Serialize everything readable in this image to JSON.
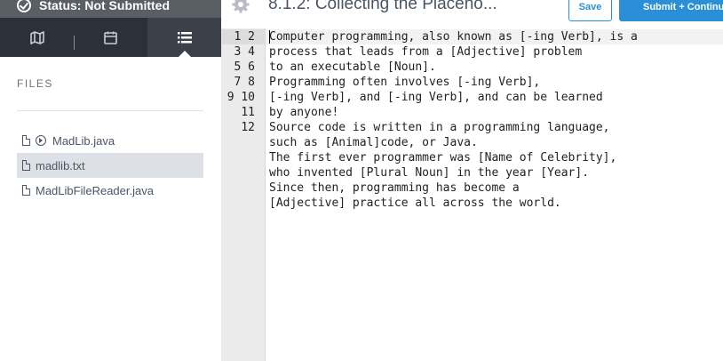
{
  "sidebar": {
    "status_text": "Status: Not Submitted",
    "files_heading": "FILES",
    "tabs": [
      {
        "name": "map-icon"
      },
      {
        "name": "calendar-icon"
      },
      {
        "name": "list-icon"
      }
    ],
    "files": [
      {
        "label": "MadLib.java",
        "runnable": true
      },
      {
        "label": "madlib.txt",
        "selected": true
      },
      {
        "label": "MadLibFileReader.java"
      }
    ]
  },
  "header": {
    "title": "8.1.2: Collecting the Placeho...",
    "save_label": "Save",
    "submit_label": "Submit + Continue"
  },
  "editor": {
    "line_numbers": "1\n2\n3\n4\n5\n6\n7\n8\n9\n10\n11\n12",
    "content": "Computer programming, also known as [-ing Verb], is a\nprocess that leads from a [Adjective] problem\nto an executable [Noun].\nProgramming often involves [-ing Verb],\n[-ing Verb], and [-ing Verb], and can be learned\nby anyone!\nSource code is written in a programming language,\nsuch as [Animal]code, or Java.\nThe first ever programmer was [Name of Celebrity],\nwho invented [Plural Noun] in the year [Year].\nSince then, programming has become a\n[Adjective] practice all across the world."
  },
  "colors": {
    "accent": "#2b8fd8",
    "sidebar_dark": "#2c3038",
    "status_bar": "#5a5f66"
  }
}
